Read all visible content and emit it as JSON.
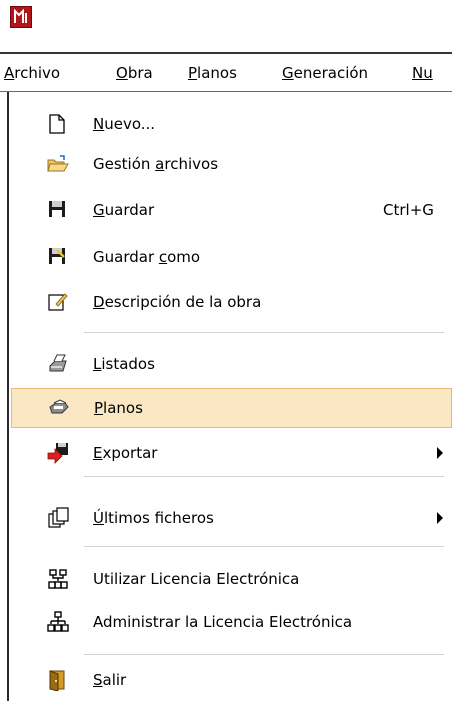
{
  "menubar": {
    "items": [
      {
        "prefix": "",
        "underline": "A",
        "rest": "rchivo"
      },
      {
        "prefix": "",
        "underline": "O",
        "rest": "bra"
      },
      {
        "prefix": "",
        "underline": "P",
        "rest": "lanos"
      },
      {
        "prefix": "",
        "underline": "G",
        "rest": "eneración"
      },
      {
        "prefix": "",
        "underline": "",
        "rest": "Nu"
      }
    ]
  },
  "menu": {
    "items": [
      {
        "pre": "",
        "u": "N",
        "post": "uevo..."
      },
      {
        "pre": "Gestión ",
        "u": "a",
        "post": "rchivos"
      },
      {
        "pre": "",
        "u": "G",
        "post": "uardar",
        "shortcut": "Ctrl+G"
      },
      {
        "pre": "Guardar ",
        "u": "c",
        "post": "omo"
      },
      {
        "pre": "",
        "u": "D",
        "post": "escripción de la obra"
      },
      {
        "pre": "",
        "u": "L",
        "post": "istados"
      },
      {
        "pre": "",
        "u": "P",
        "post": "lanos"
      },
      {
        "pre": "",
        "u": "E",
        "post": "xportar"
      },
      {
        "pre": "",
        "u": "Ú",
        "post": "ltimos ficheros"
      },
      {
        "pre": "",
        "u": "",
        "post": "Utilizar Licencia Electrónica"
      },
      {
        "pre": "",
        "u": "",
        "post": "Administrar la Licencia Electrónica"
      },
      {
        "pre": "",
        "u": "S",
        "post": "alir"
      }
    ]
  },
  "colors": {
    "highlight": "#fbe7c3",
    "highlight_border": "#e9b970",
    "app_icon": "#b3141b"
  }
}
